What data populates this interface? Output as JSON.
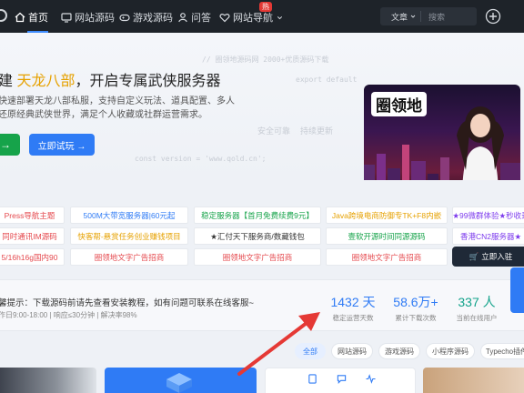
{
  "nav": {
    "items": [
      {
        "label": "首页",
        "icon": "home-icon"
      },
      {
        "label": "网站源码",
        "icon": "monitor-icon"
      },
      {
        "label": "游戏源码",
        "icon": "gamepad-icon"
      },
      {
        "label": "问答",
        "icon": "user-icon"
      },
      {
        "label": "网站导航",
        "icon": "heart-icon"
      }
    ],
    "hot_badge": "热",
    "search_type": "文章",
    "search_placeholder": "搜索"
  },
  "hero": {
    "code_lines": [
      "// 圈领地源码网 2000+优质源码下载",
      "export default",
      "const version = 'www.qold.cn';",
      "安全可靠",
      "持续更新"
    ],
    "title_pre": "建 ",
    "title_highlight": "天龙八部",
    "title_post": "，开启专属武侠服务器",
    "desc_line1": "快速部署天龙八部私服，支持自定义玩法、道具配置、多人",
    "desc_line2": "还原经典武侠世界，满足个人收藏或社群运营需求。",
    "btn_green": "→",
    "btn_blue": "立即试玩 →",
    "image_brand": "圈领地"
  },
  "links": {
    "row1": [
      {
        "text": "Press导航主题",
        "color": "#e5484d"
      },
      {
        "text": "500M大带宽服务器|60元起",
        "color": "#2f7bf5"
      },
      {
        "text": "稳定服务器【首月免费续费9元】",
        "color": "#16a34a"
      },
      {
        "text": "Java跨境电商防御专TK+F8内嵌",
        "color": "#e6a100"
      },
      {
        "text": "★99微群体验★秒收录",
        "color": "#7c3aed"
      }
    ],
    "row2": [
      {
        "text": "同时通讯IM源码",
        "color": "#e5484d"
      },
      {
        "text": "快客帮-悬赏任务创业赚钱项目",
        "color": "#e6a100"
      },
      {
        "text": "★汇付天下服务商/数藏钱包",
        "color": "#333333"
      },
      {
        "text": "壹软开源时间同源源码",
        "color": "#16a34a"
      },
      {
        "text": "香港CN2服务器★",
        "color": "#7c3aed"
      }
    ],
    "row3": [
      {
        "text": "5/16h16g国内90",
        "color": "#e5484d"
      },
      {
        "text": "圈领地文字广告招商",
        "color": "#e5484d"
      },
      {
        "text": "圈领地文字广告招商",
        "color": "#e5484d"
      },
      {
        "text": "圈领地文字广告招商",
        "color": "#e5484d"
      },
      {
        "text": "立即入驻",
        "color": "#ffffff"
      }
    ]
  },
  "notice": {
    "title": "馨提示：下载源码前请先查看安装教程，如有问题可联系在线客服~",
    "sub": "作日9:00-18:00 | 响应≤30分钟 | 解决率98%"
  },
  "stats": [
    {
      "value": "1432 天",
      "label": "稳定运营天数"
    },
    {
      "value": "58.6万+",
      "label": "累计下载次数"
    },
    {
      "value": "337 人",
      "label": "当前在线用户"
    }
  ],
  "filters": [
    "全部",
    "网站源码",
    "游戏源码",
    "小程序源码",
    "Typecho插件"
  ],
  "colors": {
    "nav_bg": "#1e2329",
    "accent": "#2f7bf5",
    "green": "#16a34a",
    "highlight": "#e6a100",
    "arrow": "#e53935"
  }
}
